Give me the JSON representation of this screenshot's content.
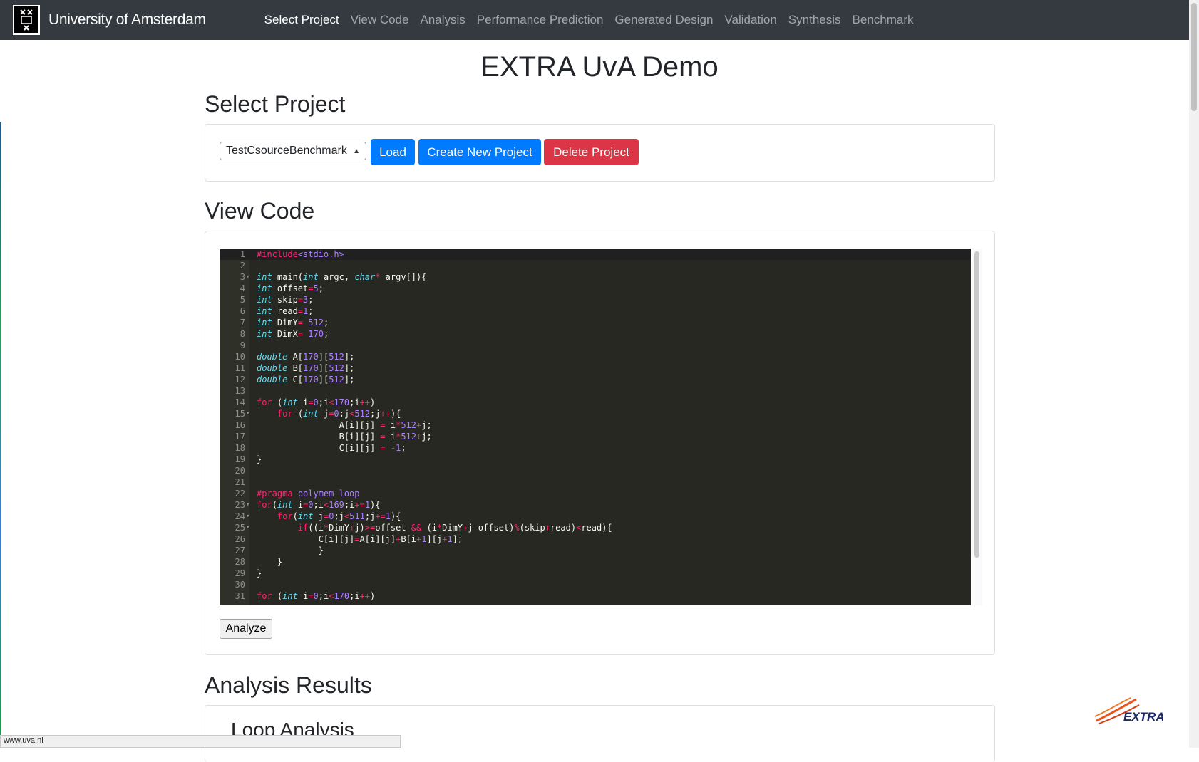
{
  "navbar": {
    "brand": "University of Amsterdam",
    "items": [
      {
        "label": "Select Project",
        "active": true
      },
      {
        "label": "View Code",
        "active": false
      },
      {
        "label": "Analysis",
        "active": false
      },
      {
        "label": "Performance Prediction",
        "active": false
      },
      {
        "label": "Generated Design",
        "active": false
      },
      {
        "label": "Validation",
        "active": false
      },
      {
        "label": "Synthesis",
        "active": false
      },
      {
        "label": "Benchmark",
        "active": false
      }
    ]
  },
  "page": {
    "title": "EXTRA UvA Demo"
  },
  "select_project": {
    "heading": "Select Project",
    "selected_project": "TestCsourceBenchmark",
    "load_label": "Load",
    "create_label": "Create New Project",
    "delete_label": "Delete Project"
  },
  "view_code": {
    "heading": "View Code",
    "analyze_label": "Analyze",
    "lines": [
      {
        "n": "1",
        "fold": "",
        "html": "<span class='pre'>#include</span><span class='prearg'>&lt;stdio.h&gt;</span>"
      },
      {
        "n": "2",
        "fold": "",
        "html": ""
      },
      {
        "n": "3",
        "fold": "-",
        "html": "<span class='kw'>int</span> main(<span class='kw'>int</span> argc, <span class='kw'>char</span><span class='op'>*</span> argv[]){"
      },
      {
        "n": "4",
        "fold": "",
        "html": "<span class='kw'>int</span> offset<span class='op'>=</span><span class='num'>5</span>;"
      },
      {
        "n": "5",
        "fold": "",
        "html": "<span class='kw'>int</span> skip<span class='op'>=</span><span class='num'>3</span>;"
      },
      {
        "n": "6",
        "fold": "",
        "html": "<span class='kw'>int</span> read<span class='op'>=</span><span class='num'>1</span>;"
      },
      {
        "n": "7",
        "fold": "",
        "html": "<span class='kw'>int</span> DimY<span class='op'>=</span> <span class='num'>512</span>;"
      },
      {
        "n": "8",
        "fold": "",
        "html": "<span class='kw'>int</span> DimX<span class='op'>=</span> <span class='num'>170</span>;"
      },
      {
        "n": "9",
        "fold": "",
        "html": ""
      },
      {
        "n": "10",
        "fold": "",
        "html": "<span class='kw'>double</span> A[<span class='num'>170</span>][<span class='num'>512</span>];"
      },
      {
        "n": "11",
        "fold": "",
        "html": "<span class='kw'>double</span> B[<span class='num'>170</span>][<span class='num'>512</span>];"
      },
      {
        "n": "12",
        "fold": "",
        "html": "<span class='kw'>double</span> C[<span class='num'>170</span>][<span class='num'>512</span>];"
      },
      {
        "n": "13",
        "fold": "",
        "html": ""
      },
      {
        "n": "14",
        "fold": "",
        "html": "<span class='ctl'>for</span> (<span class='kw'>int</span> i<span class='op'>=</span><span class='num'>0</span>;i<span class='op'>&lt;</span><span class='num'>170</span>;i<span class='op'>++</span>)"
      },
      {
        "n": "15",
        "fold": "-",
        "html": "    <span class='ctl'>for</span> (<span class='kw'>int</span> j<span class='op'>=</span><span class='num'>0</span>;j<span class='op'>&lt;</span><span class='num'>512</span>;j<span class='op'>++</span>){"
      },
      {
        "n": "16",
        "fold": "",
        "html": "                A[i][j] <span class='op'>=</span> i<span class='op'>*</span><span class='num'>512</span><span class='op'>+</span>j;"
      },
      {
        "n": "17",
        "fold": "",
        "html": "                B[i][j] <span class='op'>=</span> i<span class='op'>*</span><span class='num'>512</span><span class='op'>+</span>j;"
      },
      {
        "n": "18",
        "fold": "",
        "html": "                C[i][j] <span class='op'>=</span> <span class='op'>-</span><span class='num'>1</span>;"
      },
      {
        "n": "19",
        "fold": "",
        "html": "}"
      },
      {
        "n": "20",
        "fold": "",
        "html": ""
      },
      {
        "n": "21",
        "fold": "",
        "html": ""
      },
      {
        "n": "22",
        "fold": "",
        "html": "<span class='pre'>#pragma</span> <span class='prearg'>polymem loop</span>"
      },
      {
        "n": "23",
        "fold": "-",
        "html": "<span class='ctl'>for</span>(<span class='kw'>int</span> i<span class='op'>=</span><span class='num'>0</span>;i<span class='op'>&lt;</span><span class='num'>169</span>;i<span class='op'>+=</span><span class='num'>1</span>){"
      },
      {
        "n": "24",
        "fold": "-",
        "html": "    <span class='ctl'>for</span>(<span class='kw'>int</span> j<span class='op'>=</span><span class='num'>0</span>;j<span class='op'>&lt;</span><span class='num'>511</span>;j<span class='op'>+=</span><span class='num'>1</span>){"
      },
      {
        "n": "25",
        "fold": "-",
        "html": "        <span class='ctl'>if</span>((i<span class='op'>*</span>DimY<span class='op'>+</span>j)<span class='op'>&gt;=</span>offset <span class='op'>&amp;&amp;</span> (i<span class='op'>*</span>DimY<span class='op'>+</span>j<span class='op'>-</span>offset)<span class='op'>%</span>(skip<span class='op'>+</span>read)<span class='op'>&lt;</span>read){"
      },
      {
        "n": "26",
        "fold": "",
        "html": "            C[i][j]<span class='op'>=</span>A[i][j]<span class='op'>+</span>B[i<span class='op'>+</span><span class='num'>1</span>][j<span class='op'>+</span><span class='num'>1</span>];"
      },
      {
        "n": "27",
        "fold": "",
        "html": "            }"
      },
      {
        "n": "28",
        "fold": "",
        "html": "    }"
      },
      {
        "n": "29",
        "fold": "",
        "html": "}"
      },
      {
        "n": "30",
        "fold": "",
        "html": ""
      },
      {
        "n": "31",
        "fold": "",
        "html": "<span class='ctl'>for</span> (<span class='kw'>int</span> i<span class='op'>=</span><span class='num'>0</span>;i<span class='op'>&lt;</span><span class='num'>170</span>;i<span class='op'>++</span>)"
      }
    ]
  },
  "analysis": {
    "heading": "Analysis Results",
    "subheading": "Loop Analysis"
  },
  "status_bar": {
    "url": "www.uva.nl"
  },
  "footer_logo": {
    "text": "EXTRA"
  },
  "colors": {
    "navbar": "#343a40",
    "primary": "#007bff",
    "danger": "#dc3545",
    "editor_bg": "#272822"
  }
}
